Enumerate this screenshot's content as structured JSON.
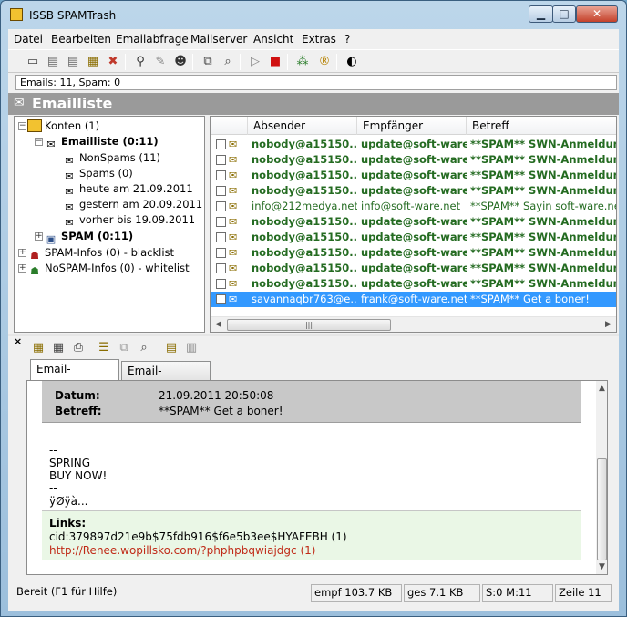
{
  "window": {
    "title": "ISSB SPAMTrash"
  },
  "menu": [
    "Datei",
    "Bearbeiten",
    "Emailabfrage",
    "Mailserver",
    "Ansicht",
    "Extras",
    "?"
  ],
  "info_line": "Emails: 11, Spam: 0",
  "section_title": "Emailliste",
  "tree": {
    "konten": "Konten (1)",
    "emailliste": "Emailliste (0:11)",
    "nonspams": "NonSpams (11)",
    "spams": "Spams (0)",
    "heute": "heute am 21.09.2011",
    "gestern": "gestern am 20.09.2011",
    "vorher": "vorher bis 19.09.2011",
    "spam": "SPAM (0:11)",
    "spam_infos": "SPAM-Infos (0) - blacklist",
    "nospam_infos": "NoSPAM-Infos (0) - whitelist"
  },
  "list": {
    "columns": [
      "Absender",
      "Empfänger",
      "Betreff"
    ],
    "rows": [
      {
        "sender": "nobody@a15150...",
        "recipient": "update@soft-ware...",
        "subject": "**SPAM** SWN-Anmeldung:",
        "style": "spam"
      },
      {
        "sender": "nobody@a15150...",
        "recipient": "update@soft-ware...",
        "subject": "**SPAM** SWN-Anmeldung:",
        "style": "spam"
      },
      {
        "sender": "nobody@a15150...",
        "recipient": "update@soft-ware...",
        "subject": "**SPAM** SWN-Anmeldung:",
        "style": "spam"
      },
      {
        "sender": "nobody@a15150...",
        "recipient": "update@soft-ware...",
        "subject": "**SPAM** SWN-Anmeldung:",
        "style": "spam"
      },
      {
        "sender": "info@212medya.net",
        "recipient": "info@soft-ware.net",
        "subject": "**SPAM** Sayin soft-ware.net",
        "style": "normal"
      },
      {
        "sender": "nobody@a15150...",
        "recipient": "update@soft-ware...",
        "subject": "**SPAM** SWN-Anmeldung:",
        "style": "spam"
      },
      {
        "sender": "nobody@a15150...",
        "recipient": "update@soft-ware...",
        "subject": "**SPAM** SWN-Anmeldung:",
        "style": "spam"
      },
      {
        "sender": "nobody@a15150...",
        "recipient": "update@soft-ware...",
        "subject": "**SPAM** SWN-Anmeldung:",
        "style": "spam"
      },
      {
        "sender": "nobody@a15150...",
        "recipient": "update@soft-ware...",
        "subject": "**SPAM** SWN-Anmeldung:",
        "style": "spam"
      },
      {
        "sender": "nobody@a15150...",
        "recipient": "update@soft-ware...",
        "subject": "**SPAM** SWN-Anmeldung:",
        "style": "spam"
      },
      {
        "sender": "savannaqbr763@e...",
        "recipient": "frank@soft-ware.net",
        "subject": "**SPAM** Get a boner!",
        "style": "selected"
      }
    ]
  },
  "tabs": [
    "Email-Vorschau",
    "Email-Kopfdaten"
  ],
  "preview": {
    "date_label": "Datum:",
    "date_value": "21.09.2011 20:50:08",
    "subject_label": "Betreff:",
    "subject_value": "**SPAM** Get a boner!",
    "body_lines": [
      "--",
      "SPRING",
      "BUY NOW!",
      "--",
      "ÿØÿà..."
    ],
    "links_label": "Links:",
    "link_cid": "cid:379897d21e9b$75fdb916$f6e5b3ee$HYAFEBH (1)",
    "link_url": "http://Renee.wopillsko.com/?phphpbqwiajdgc (1)"
  },
  "status": {
    "help": "Bereit (F1 für Hilfe)",
    "received": "empf 103.7 KB",
    "total": "ges 7.1 KB",
    "counts": "S:0 M:11",
    "line": "Zeile 11"
  },
  "colors": {
    "spam_text": "#246b21",
    "selected_row": "#3399ff",
    "link_red": "#c02b18",
    "links_bg": "#eaf7e6"
  }
}
